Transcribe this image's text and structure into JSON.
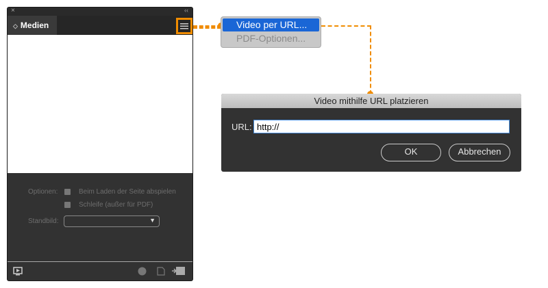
{
  "panel": {
    "close_icon": "×",
    "collapse_icon": "‹‹",
    "tab_label": "Medien",
    "options_label": "Optionen:",
    "option1": "Beim Laden der Seite abspielen",
    "option2": "Schleife (außer für PDF)",
    "poster_label": "Standbild:",
    "poster_value": ""
  },
  "menu": {
    "items": [
      {
        "label": "Video per URL...",
        "highlighted": true,
        "enabled": true
      },
      {
        "label": "PDF-Optionen...",
        "highlighted": false,
        "enabled": false
      }
    ]
  },
  "dialog": {
    "title": "Video mithilfe URL platzieren",
    "url_label": "URL:",
    "url_value": "http://",
    "ok": "OK",
    "cancel": "Abbrechen"
  },
  "colors": {
    "accent": "#f08c00",
    "highlight": "#1a66d6",
    "panel": "#323232"
  }
}
